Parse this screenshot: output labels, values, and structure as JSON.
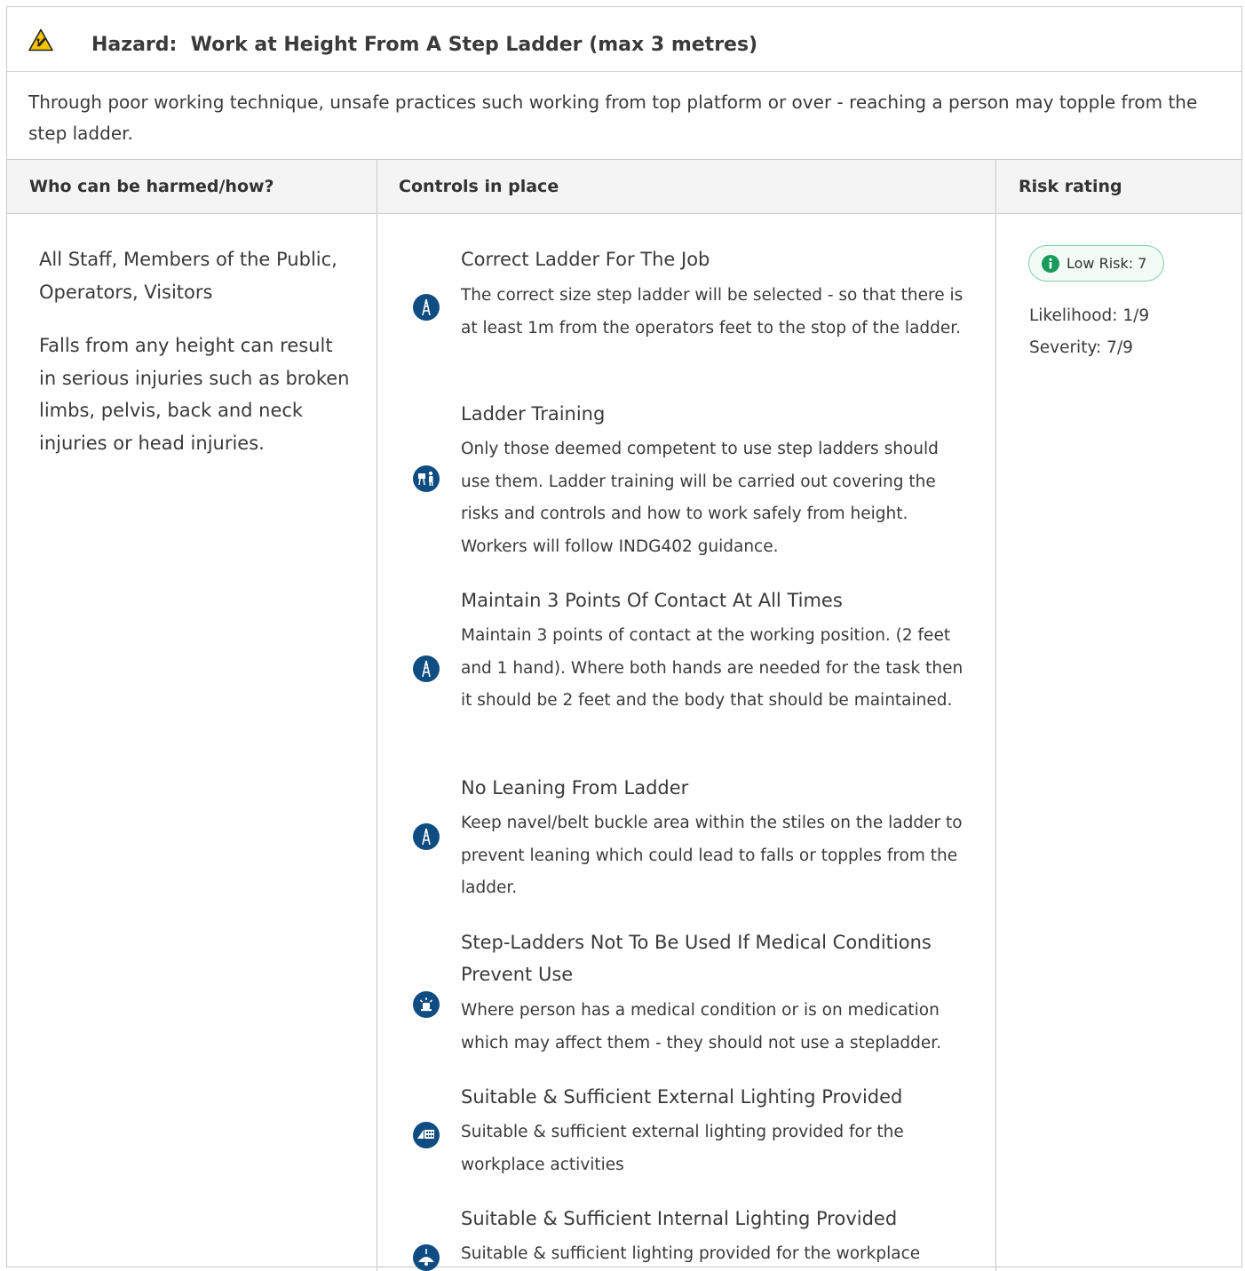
{
  "hazard": {
    "prefix": "Hazard:",
    "title": "Work at Height From A Step Ladder (max 3 metres)",
    "description": "Through poor working technique, unsafe practices such working from top platform or over - reaching a person may topple from the step ladder."
  },
  "columns": {
    "who": "Who can be harmed/how?",
    "controls": "Controls in place",
    "risk": "Risk rating"
  },
  "who": {
    "groups": "All Staff, Members of the Public, Operators, Visitors",
    "how": "Falls from any height can result in serious injuries such as broken limbs, pelvis, back and neck injuries or head injuries."
  },
  "controls": [
    {
      "title": "Correct Ladder For The Job",
      "icon": "ladder-icon",
      "body": "The correct size step ladder will be selected - so that there is at least 1m from the operators feet to the stop of the ladder."
    },
    {
      "title": "Ladder Training",
      "icon": "training-icon",
      "body": "Only those deemed competent to use step ladders should use them. Ladder training will be carried out covering the risks and controls and how to work safely from height. Workers will follow INDG402 guidance."
    },
    {
      "title": "Maintain 3 Points Of Contact At All Times",
      "icon": "ladder-icon",
      "body": "Maintain 3 points of contact at the working position. (2 feet and 1 hand). Where both hands are needed for the task then it should be 2 feet and the body that should be maintained."
    },
    {
      "title": "No Leaning From Ladder",
      "icon": "ladder-icon",
      "body": "Keep navel/belt buckle area within the stiles on the ladder to prevent leaning which could lead to falls or topples from the ladder."
    },
    {
      "title": "Step-Ladders Not To Be Used If Medical Conditions Prevent Use",
      "icon": "alarm-icon",
      "body": "Where person has a medical condition or is on medication which may affect them - they should not use a stepladder."
    },
    {
      "title": "Suitable & Sufficient External Lighting Provided",
      "icon": "floodlight-icon",
      "body": "Suitable & sufficient external lighting provided for the workplace activities"
    },
    {
      "title": "Suitable & Sufficient Internal Lighting Provided",
      "icon": "ceiling-lamp-icon",
      "body": "Suitable & sufficient lighting provided for the workplace"
    }
  ],
  "risk": {
    "badge": "Low Risk: 7",
    "likelihood": "Likelihood: 1/9",
    "severity": "Severity: 7/9",
    "badge_color": "#1a9a5c"
  }
}
